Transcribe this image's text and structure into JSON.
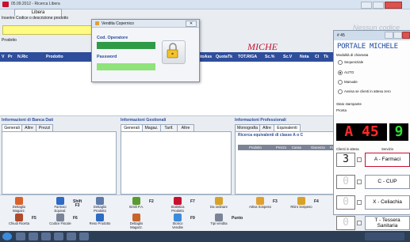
{
  "window": {
    "title": "05.09.2012 - Ricerca Libera"
  },
  "tab_main": "Libera",
  "search_label": "Inserire Codice o descrizione prodotto",
  "prodotto_label": "Prodotto",
  "brand": "MICHE",
  "nessun_codice": "Nessun codice",
  "grid_headers": [
    "V",
    "Pr",
    "N.Ric",
    "Prodotto",
    "ScontoAss",
    "QuotaTk",
    "TOT.RIGA",
    "Sc.%",
    "Sc.V",
    "Nota",
    "Cl",
    "Tk",
    "Um"
  ],
  "banca_dati": {
    "title": "Informazioni di Banca Dati",
    "tabs": [
      "Generali",
      "Altre",
      "Prezzi"
    ]
  },
  "gestionali": {
    "title": "Informazioni Gestionali",
    "tabs": [
      "Generali",
      "Magaz.",
      "Tarif.",
      "Altre"
    ]
  },
  "professionali": {
    "title": "Informazioni Professionali",
    "tabs": [
      "Monografia",
      "Altre",
      "Equivalenti"
    ],
    "ricerca_label": "Ricerca equivalenti di classe A o C",
    "columns": [
      "Prodotto",
      "Prezzo",
      "Cassa",
      "Giacenza",
      "Pa"
    ]
  },
  "toolbar": [
    {
      "label": "Dettaglio Magazz.",
      "key": ""
    },
    {
      "label": "Farmaci Equival.",
      "key": "Shift F3"
    },
    {
      "label": "Dettaglio Prodotto",
      "key": ""
    },
    {
      "label": "Simili P.A.",
      "key": "F2"
    },
    {
      "label": "Statistica Prodotto",
      "key": "F7"
    },
    {
      "label": "Da ordinare",
      "key": ""
    },
    {
      "label": "Attiva Sospeso",
      "key": "F3"
    },
    {
      "label": "Ritiro Sospeso",
      "key": "F4"
    },
    {
      "label": "Chiudi Ricetta",
      "key": "F5"
    },
    {
      "label": "Codice Fiscale",
      "key": "F6"
    },
    {
      "label": "Reso Prodotto",
      "key": ""
    },
    {
      "label": "Dettaglio Magazz.",
      "key": ""
    },
    {
      "label": "Storico Vendite",
      "key": "F9"
    },
    {
      "label": "Tipi vendita",
      "key": "Punto"
    }
  ],
  "popup": {
    "title": "Vendita Copernico",
    "operatore_label": "Cod. Operatore",
    "password_label": "Password"
  },
  "portale": {
    "window_title": "# 45",
    "title": "PORTALE MICHELE",
    "modalita_label": "Modalità di chiamata",
    "options": [
      "Sequenziale",
      "AUTO",
      "Manuale",
      "Avvisa se clienti in attesa zero"
    ],
    "selected_option": "AUTO",
    "stato_label": "Stato stampante",
    "stato_value": "Pronta",
    "display_letter": "A",
    "display_number": "45",
    "display_extra": "9",
    "clienti_label": "Clienti in attesa",
    "servizio_label": "Servizio",
    "services": [
      {
        "count": "3",
        "name": "A - Farmaci"
      },
      {
        "count": "0",
        "name": "C - CUP"
      },
      {
        "count": "0",
        "name": "X - Celiachia"
      },
      {
        "count": "0",
        "name": "T - Tessera Sanitaria"
      }
    ]
  },
  "colors": {
    "header_blue": "#2e4d9b",
    "accent_red": "#c8102e",
    "operator_green": "#2f9b47",
    "password_green": "#8fe37a",
    "yellow_field": "#fffb85"
  }
}
